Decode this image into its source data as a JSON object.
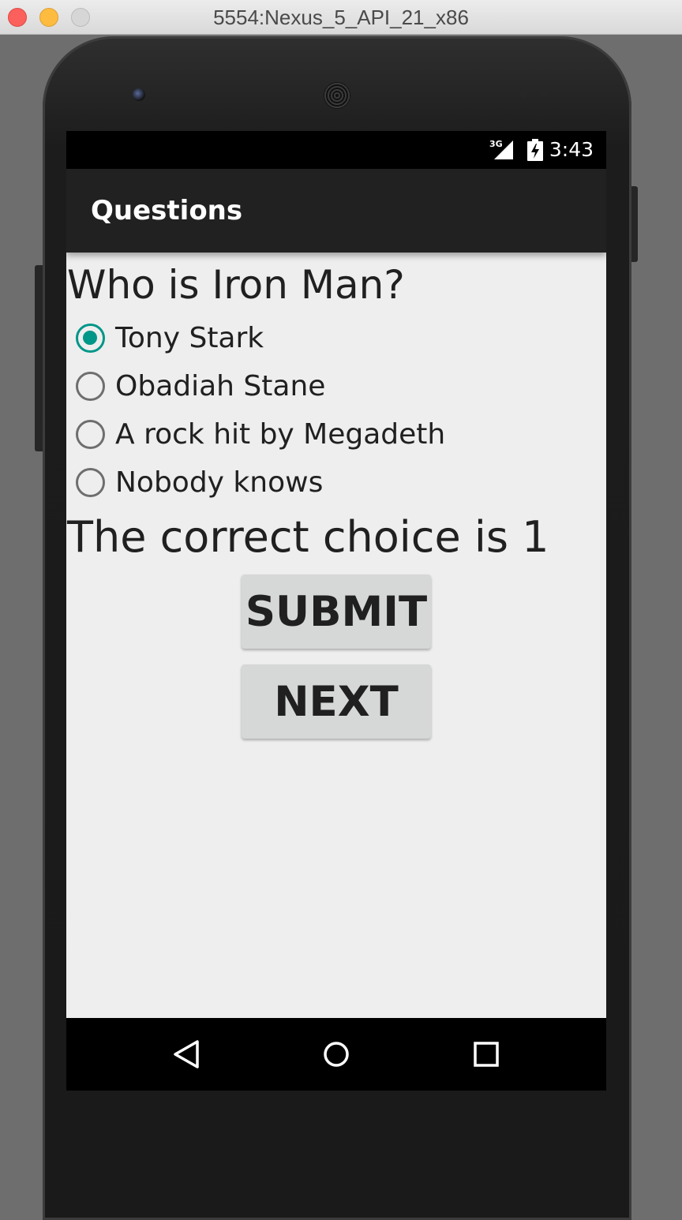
{
  "window": {
    "title": "5554:Nexus_5_API_21_x86"
  },
  "status_bar": {
    "network": "3G",
    "time": "3:43"
  },
  "app_bar": {
    "title": "Questions"
  },
  "question": {
    "text": "Who is Iron Man?"
  },
  "options": [
    {
      "label": "Tony Stark",
      "checked": true
    },
    {
      "label": "Obadiah Stane",
      "checked": false
    },
    {
      "label": "A rock hit by Megadeth",
      "checked": false
    },
    {
      "label": "Nobody knows",
      "checked": false
    }
  ],
  "result": {
    "text": "The correct choice is 1"
  },
  "buttons": {
    "submit": "SUBMIT",
    "next": "NEXT"
  },
  "nav_bar": {
    "back_icon": "back-triangle-icon",
    "home_icon": "home-circle-icon",
    "recents_icon": "recents-square-icon"
  },
  "colors": {
    "accent": "#009688",
    "app_bar": "#212121",
    "screen_bg": "#eeeeee",
    "button_bg": "#d6d7d7"
  }
}
